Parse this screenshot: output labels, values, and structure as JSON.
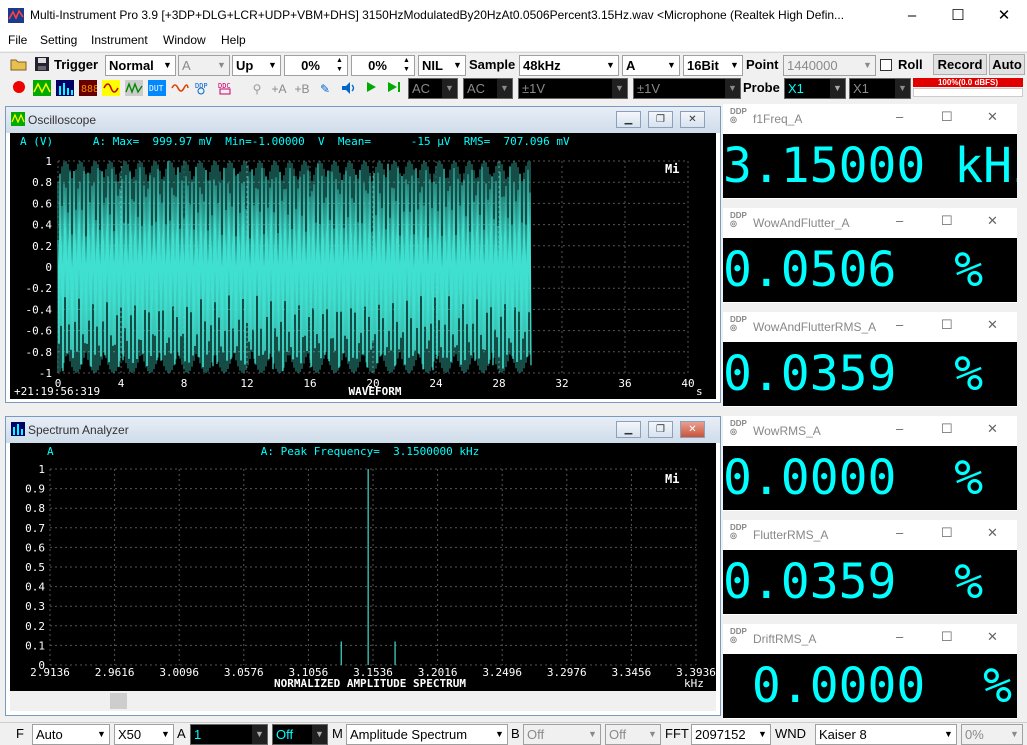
{
  "window": {
    "title": "Multi-Instrument Pro 3.9    [+3DP+DLG+LCR+UDP+VBM+DHS]    3150HzModulatedBy20HzAt0.0506Percent3.15Hz.wav    <Microphone (Realtek High Defin...",
    "minimize": "–",
    "maximize": "☐",
    "close": "✕"
  },
  "menu": [
    "File",
    "Setting",
    "Instrument",
    "Window",
    "Help"
  ],
  "toolbar1": {
    "trigger_label": "Trigger",
    "trigger_mode": "Normal",
    "trigger_source": "A",
    "trigger_edge": "Up",
    "trigger_level": "0%",
    "trigger_delay": "0%",
    "nil": "NIL",
    "sample_label": "Sample",
    "sample_rate": "48kHz",
    "channel": "A",
    "bits": "16Bit",
    "point_label": "Point",
    "points": "1440000",
    "roll_label": "Roll",
    "record_label": "Record",
    "auto_label": "Auto"
  },
  "toolbar2": {
    "coupling_a": "AC",
    "coupling_b": "AC",
    "range_a": "±1V",
    "range_b": "±1V",
    "probe_label": "Probe",
    "probe_a": "X1",
    "probe_b": "X1",
    "level_meter": "100%(0.0 dBFS)"
  },
  "oscilloscope": {
    "title": "Oscilloscope",
    "header": "A (V)      A: Max=  999.97 mV  Min=-1.00000  V  Mean=      -15 µV  RMS=  707.096 mV",
    "logo": "Mi",
    "timestamp": "+21:19:56:319",
    "footer": "WAVEFORM",
    "xunit": "s",
    "yticks": [
      "1",
      "0.8",
      "0.6",
      "0.4",
      "0.2",
      "0",
      "-0.2",
      "-0.4",
      "-0.6",
      "-0.8",
      "-1"
    ],
    "xticks": [
      "0",
      "4",
      "8",
      "12",
      "16",
      "20",
      "24",
      "28",
      "32",
      "36",
      "40"
    ]
  },
  "spectrum": {
    "title": "Spectrum Analyzer",
    "header": "A: Peak Frequency=  3.1500000 kHz",
    "ylabel": "A",
    "logo": "Mi",
    "footer": "NORMALIZED AMPLITUDE SPECTRUM",
    "xunit": "kHz",
    "yticks": [
      "1",
      "0.9",
      "0.8",
      "0.7",
      "0.6",
      "0.5",
      "0.4",
      "0.3",
      "0.2",
      "0.1",
      "0"
    ],
    "xticks": [
      "2.9136",
      "2.9616",
      "3.0096",
      "3.0576",
      "3.1056",
      "3.1536",
      "3.2016",
      "3.2496",
      "3.2976",
      "3.3456",
      "3.3936"
    ]
  },
  "chart_data": [
    {
      "type": "line",
      "title": "WAVEFORM",
      "xlabel": "s",
      "ylabel": "A (V)",
      "xlim": [
        0,
        40
      ],
      "ylim": [
        -1,
        1
      ],
      "grid": true,
      "series": [
        {
          "name": "A",
          "color": "#40e0d0",
          "x_range": [
            0,
            30
          ],
          "amplitude": 1.0
        }
      ]
    },
    {
      "type": "bar",
      "title": "NORMALIZED AMPLITUDE SPECTRUM",
      "xlabel": "kHz",
      "ylabel": "A",
      "xlim": [
        2.9136,
        3.3936
      ],
      "ylim": [
        0,
        1
      ],
      "grid": true,
      "series": [
        {
          "name": "A",
          "color": "#40e0d0",
          "x": [
            3.13,
            3.15,
            3.17
          ],
          "values": [
            0.12,
            1.0,
            0.12
          ]
        }
      ]
    }
  ],
  "readouts": [
    {
      "title": "f1Freq_A",
      "value": "3.15000 kHz"
    },
    {
      "title": "WowAndFlutter_A",
      "value": "0.0506  %"
    },
    {
      "title": "WowAndFlutterRMS_A",
      "value": "0.0359  %"
    },
    {
      "title": "WowRMS_A",
      "value": "0.0000  %"
    },
    {
      "title": "FlutterRMS_A",
      "value": "0.0359  %"
    },
    {
      "title": "DriftRMS_A",
      "value": " 0.0000  %"
    }
  ],
  "statusbar": {
    "f_label": "F",
    "freq_mode": "Auto",
    "zoom": "X50",
    "a_label": "A",
    "a_value": "1",
    "a_state": "Off",
    "m_label": "M",
    "analysis": "Amplitude Spectrum",
    "b_label": "B",
    "b_value": "Off",
    "b_state": "Off",
    "fft_label": "FFT",
    "fft_size": "2097152",
    "wnd_label": "WND",
    "window_fn": "Kaiser 8",
    "overlap": "0%"
  },
  "colors": {
    "trace": "#40e0d0",
    "readout": "#00ffff",
    "grid": "#555555",
    "plot_bg": "#000000"
  }
}
